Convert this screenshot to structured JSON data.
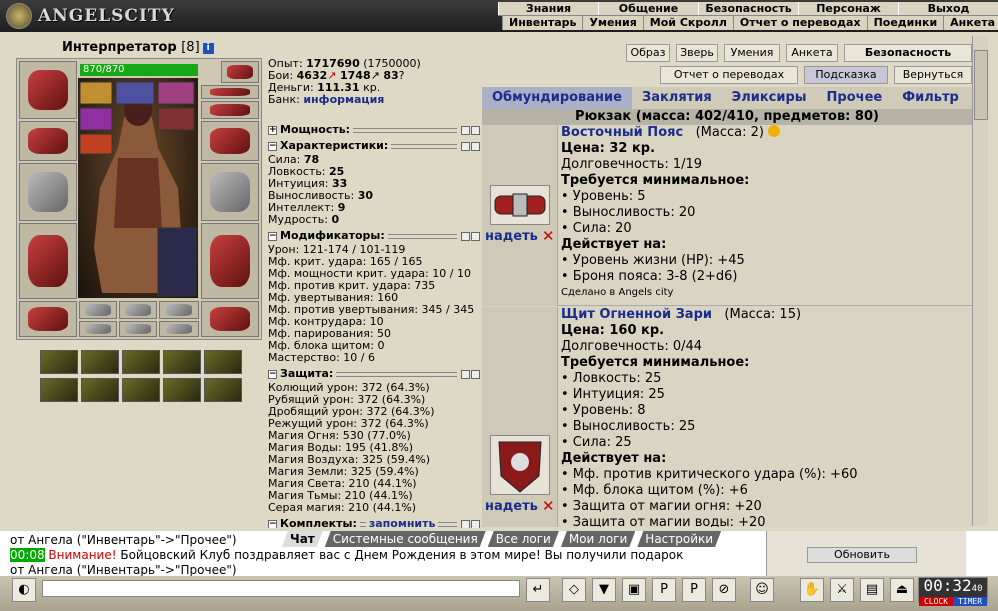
{
  "app": {
    "logo_text": "ANGELSCITY"
  },
  "topmenu": [
    "Знания",
    "Общение",
    "Безопасность",
    "Персонаж",
    "Выход"
  ],
  "submenu": [
    "Инвентарь",
    "Умения",
    "Мой Скролл",
    "Отчет о переводах",
    "Поединки",
    "Анкета"
  ],
  "character": {
    "name": "Интерпретатор",
    "level": "[8]",
    "hp_text": "870/870",
    "hp_fraction": 1.0
  },
  "stats": {
    "exp_label": "Опыт:",
    "exp_value": "1717690",
    "exp_next": "(1750000)",
    "fights_label": "Бои:",
    "wins": "4632",
    "losses": "1748",
    "draws": "83",
    "money_label": "Деньги:",
    "money_value": "111.31",
    "money_unit": "кр.",
    "bank_label": "Банк:",
    "bank_link": "информация"
  },
  "sections": {
    "power": "Мощность:",
    "chars": "Характеристики:",
    "chars_rows": [
      {
        "l": "Сила:",
        "v": "78"
      },
      {
        "l": "Ловкость:",
        "v": "25"
      },
      {
        "l": "Интуиция:",
        "v": "33"
      },
      {
        "l": "Выносливость:",
        "v": "30"
      },
      {
        "l": "Интеллект:",
        "v": "9"
      },
      {
        "l": "Мудрость:",
        "v": "0"
      }
    ],
    "mods": "Модификаторы:",
    "mods_rows": [
      "Урон: 121-174 / 101-119",
      "Мф. крит. удара: 165 / 165",
      "Мф. мощности крит. удара: 10 / 10",
      "Мф. против крит. удара: 735",
      "Мф. увертывания: 160",
      "Мф. против увертывания: 345 / 345",
      "Мф. контрудара: 10",
      "Мф. парирования: 50",
      "Мф. блока щитом: 0",
      "Мастерство: 10 / 6"
    ],
    "defense": "Защита:",
    "defense_rows": [
      "Колющий урон: 372 (64.3%)",
      "Рубящий урон: 372 (64.3%)",
      "Дробящий урон: 372 (64.3%)",
      "Режущий урон: 372 (64.3%)",
      "Магия Огня: 530 (77.0%)",
      "Магия Воды: 195 (41.8%)",
      "Магия Воздуха: 325 (59.4%)",
      "Магия Земли: 325 (59.4%)",
      "Магия Света: 210 (44.1%)",
      "Магия Тьмы: 210 (44.1%)",
      "Серая магия: 210 (44.1%)"
    ],
    "sets": "Комплекты:",
    "sets_link": "запомнить"
  },
  "buttons": {
    "row1": [
      "Образ",
      "Зверь",
      "Умения",
      "Анкета",
      "Безопасность"
    ],
    "row2": [
      "Отчет о переводах",
      "Подсказка",
      "Вернуться"
    ]
  },
  "tabs": [
    "Обмундирование",
    "Заклятия",
    "Эликсиры",
    "Прочее",
    "Фильтр"
  ],
  "backpack": "Рюкзак (масса: 402/410, предметов: 80)",
  "items": [
    {
      "title": "Восточный Пояс",
      "mass": "(Масса: 2)",
      "price": "Цена: 32 кр.",
      "dur": "Долговечность: 1/19",
      "req_h": "Требуется минимальное:",
      "req": [
        "• Уровень: 5",
        "• Выносливость: 20",
        "• Сила: 20"
      ],
      "eff_h": "Действует на:",
      "eff": [
        "• Уровень жизни (HP): +45",
        "• Броня пояса: 3-8 (2+d6)"
      ],
      "note": "Сделано в Angels city",
      "wear": "надеть"
    },
    {
      "title": "Щит Огненной Зари",
      "mass": "(Масса: 15)",
      "price": "Цена: 160 кр.",
      "dur": "Долговечность: 0/44",
      "req_h": "Требуется минимальное:",
      "req": [
        "• Ловкость: 25",
        "• Интуиция: 25",
        "• Уровень: 8",
        "• Выносливость: 25",
        "• Сила: 25"
      ],
      "eff_h": "Действует на:",
      "eff": [
        "• Мф. против критического удара (%): +60",
        "• Мф. блока щитом (%): +6",
        "• Защита от магии огня: +20",
        "• Защита от магии воды: +20"
      ],
      "wear": "надеть"
    }
  ],
  "chat": {
    "tabs": [
      "Чат",
      "Системные сообщения",
      "Все логи",
      "Мои логи",
      "Настройки"
    ],
    "line1": "от Ангела (\"Инвентарь\"->\"Прочее\")",
    "time": "00:08",
    "warn": "Внимание!",
    "line2": " Бойцовский Клуб поздравляет вас с Днем Рождения в этом мире! Вы получили подарок",
    "line3": "от Ангела (\"Инвентарь\"->\"Прочее\")",
    "refresh": "Обновить"
  },
  "clock": {
    "time": "00:32",
    "sec": "40",
    "clock_label": "CLOCK",
    "timer_label": "TIMER"
  }
}
